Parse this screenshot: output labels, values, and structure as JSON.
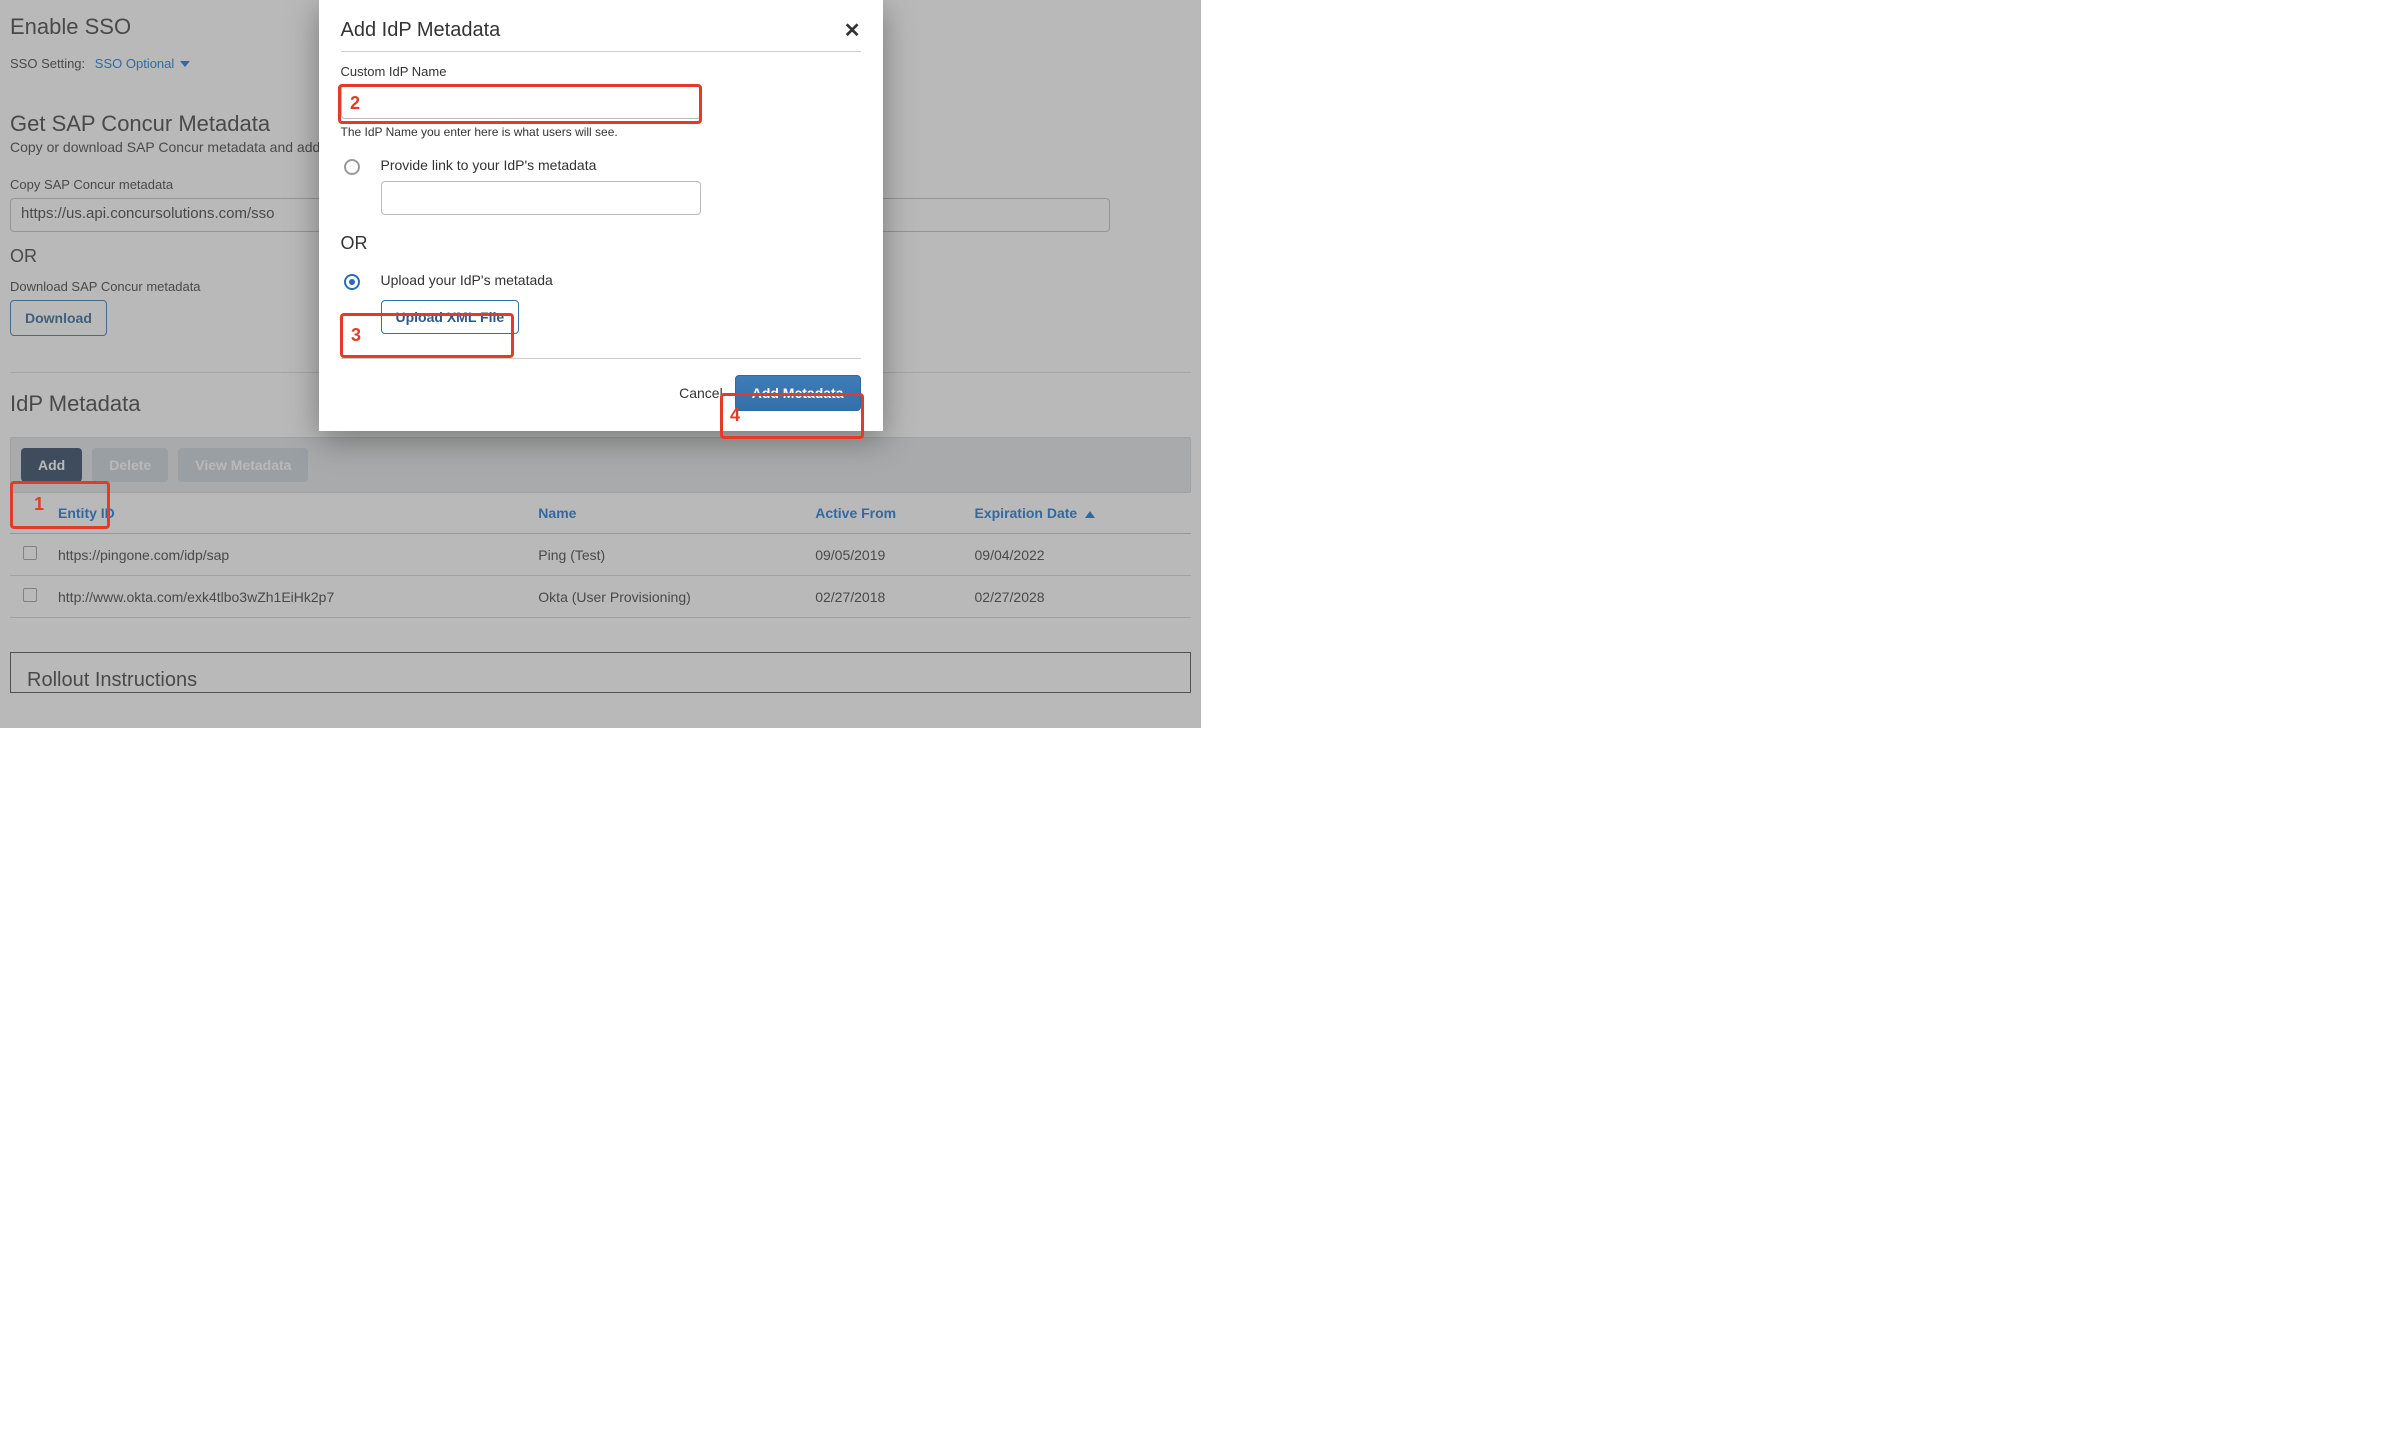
{
  "page": {
    "enable_sso_title": "Enable SSO",
    "sso_setting_label": "SSO Setting:",
    "sso_setting_value": "SSO Optional",
    "get_metadata_title": "Get SAP Concur Metadata",
    "get_metadata_desc": "Copy or download SAP Concur metadata and add",
    "copy_metadata_label": "Copy SAP Concur metadata",
    "copy_metadata_value": "https://us.api.concursolutions.com/sso",
    "or_label": "OR",
    "download_metadata_label": "Download SAP Concur metadata",
    "download_btn": "Download",
    "idp_metadata_title": "IdP Metadata",
    "toolbar": {
      "add": "Add",
      "delete": "Delete",
      "view": "View Metadata"
    },
    "rollout_title": "Rollout Instructions"
  },
  "table": {
    "headers": {
      "entity": "Entity ID",
      "name": "Name",
      "active": "Active From",
      "exp": "Expiration Date"
    },
    "rows": [
      {
        "entity": "https://pingone.com/idp/sap",
        "name": "Ping (Test)",
        "active": "09/05/2019",
        "exp": "09/04/2022"
      },
      {
        "entity": "http://www.okta.com/exk4tlbo3wZh1EiHk2p7",
        "name": "Okta (User Provisioning)",
        "active": "02/27/2018",
        "exp": "02/27/2028"
      }
    ]
  },
  "modal": {
    "title": "Add IdP Metadata",
    "custom_name_label": "Custom IdP Name",
    "custom_name_help": "The IdP Name you enter here is what users will see.",
    "provide_link_label": "Provide link to your IdP's metadata",
    "or_label": "OR",
    "upload_label": "Upload your IdP's metatada",
    "upload_btn": "Upload XML File",
    "cancel": "Cancel",
    "submit": "Add Metadata"
  },
  "annotations": {
    "n1": "1",
    "n2": "2",
    "n3": "3",
    "n4": "4"
  }
}
